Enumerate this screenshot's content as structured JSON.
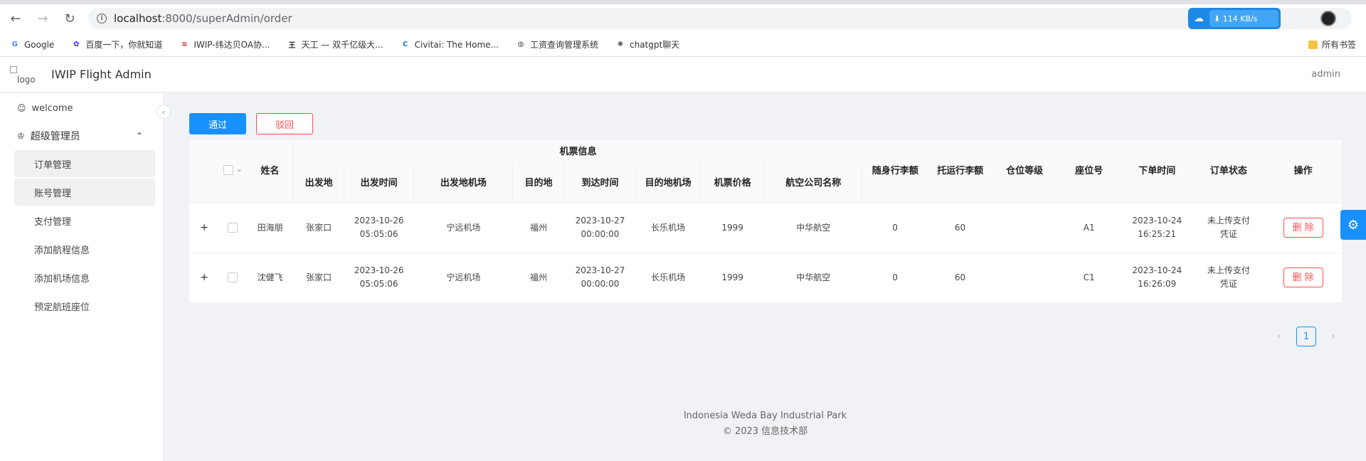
{
  "browser": {
    "url_host": "localhost",
    "url_path": ":8000/superAdmin/order",
    "speed": "114 KB/s",
    "bookmarks": [
      {
        "label": "Google",
        "icon": "google-icon",
        "color": "#4285f4",
        "glyph": "G"
      },
      {
        "label": "百度一下，你就知道",
        "icon": "baidu-icon",
        "color": "#2932e1",
        "glyph": "✿"
      },
      {
        "label": "IWIP-纬达贝OA协...",
        "icon": "iwip-icon",
        "color": "#c0392b",
        "glyph": "≋"
      },
      {
        "label": "天工 — 双千亿级大...",
        "icon": "tiangong-icon",
        "color": "#333333",
        "glyph": "王"
      },
      {
        "label": "Civitai: The Home...",
        "icon": "civitai-icon",
        "color": "#1c7ed6",
        "glyph": "C"
      },
      {
        "label": "工资查询管理系统",
        "icon": "globe-icon",
        "color": "#555555",
        "glyph": "◍"
      },
      {
        "label": "chatgpt聊天",
        "icon": "chatgpt-icon",
        "color": "#555555",
        "glyph": "✺"
      }
    ],
    "all_bookmarks": "所有书签"
  },
  "app": {
    "logo_alt": "logo",
    "title": "IWIP Flight Admin",
    "user": "admin"
  },
  "sidebar": {
    "welcome": "welcome",
    "group": "超级管理员",
    "items": [
      "订单管理",
      "账号管理",
      "支付管理",
      "添加航程信息",
      "添加机场信息",
      "预定航班座位"
    ]
  },
  "actions": {
    "approve": "通过",
    "reject": "驳回"
  },
  "table": {
    "group_header": "机票信息",
    "headers": {
      "name": "姓名",
      "from": "出发地",
      "depart_time": "出发时间",
      "depart_airport": "出发地机场",
      "dest": "目的地",
      "arrive_time": "到达时间",
      "dest_airport": "目的地机场",
      "price": "机票价格",
      "airline": "航空公司名称",
      "carry_on": "随身行李额",
      "checked": "托运行李额",
      "cabin": "仓位等级",
      "seat": "座位号",
      "order_time": "下单时间",
      "status": "订单状态",
      "ops": "操作"
    },
    "rows": [
      {
        "expand": "+",
        "name": "田海朋",
        "from": "张家口",
        "depart_date": "2023-10-26",
        "depart_clock": "05:05:06",
        "depart_airport": "宁远机场",
        "dest": "福州",
        "arrive_date": "2023-10-27",
        "arrive_clock": "00:00:00",
        "dest_airport": "长乐机场",
        "price": "1999",
        "airline": "中华航空",
        "carry_on": "0",
        "checked": "60",
        "cabin": "",
        "seat": "A1",
        "order_date": "2023-10-24",
        "order_clock": "16:25:21",
        "status_line1": "未上传支付",
        "status_line2": "凭证",
        "delete": "删 除"
      },
      {
        "expand": "+",
        "name": "沈健飞",
        "from": "张家口",
        "depart_date": "2023-10-26",
        "depart_clock": "05:05:06",
        "depart_airport": "宁远机场",
        "dest": "福州",
        "arrive_date": "2023-10-27",
        "arrive_clock": "00:00:00",
        "dest_airport": "长乐机场",
        "price": "1999",
        "airline": "中华航空",
        "carry_on": "0",
        "checked": "60",
        "cabin": "",
        "seat": "C1",
        "order_date": "2023-10-24",
        "order_clock": "16:26:09",
        "status_line1": "未上传支付",
        "status_line2": "凭证",
        "delete": "删 除"
      }
    ]
  },
  "pagination": {
    "prev": "‹",
    "current": "1",
    "next": "›"
  },
  "footer": {
    "line1": "Indonesia Weda Bay Industrial Park",
    "line2": "© 2023 信息技术部"
  },
  "colors": {
    "primary": "#1890ff",
    "danger": "#ff4d4f"
  }
}
